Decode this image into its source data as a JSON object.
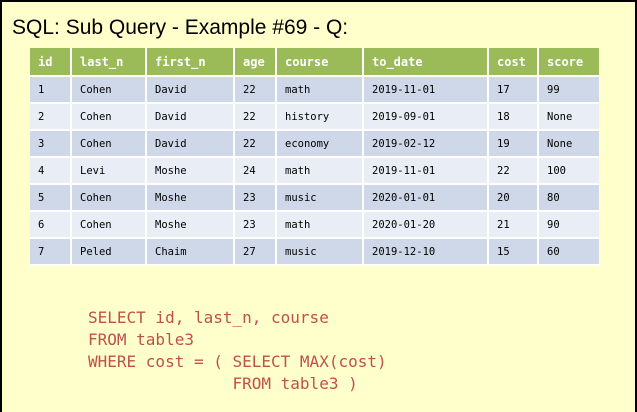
{
  "slide": {
    "title": "SQL: Sub Query - Example #69 - Q:"
  },
  "table": {
    "columns": [
      "id",
      "last_n",
      "first_n",
      "age",
      "course",
      "to_date",
      "cost",
      "score"
    ],
    "rows": [
      [
        "1",
        "Cohen",
        "David",
        "22",
        "math",
        "2019-11-01",
        "17",
        "99"
      ],
      [
        "2",
        "Cohen",
        "David",
        "22",
        "history",
        "2019-09-01",
        "18",
        "None"
      ],
      [
        "3",
        "Cohen",
        "David",
        "22",
        "economy",
        "2019-02-12",
        "19",
        "None"
      ],
      [
        "4",
        "Levi",
        "Moshe",
        "24",
        "math",
        "2019-11-01",
        "22",
        "100"
      ],
      [
        "5",
        "Cohen",
        "Moshe",
        "23",
        "music",
        "2020-01-01",
        "20",
        "80"
      ],
      [
        "6",
        "Cohen",
        "Moshe",
        "23",
        "math",
        "2020-01-20",
        "21",
        "90"
      ],
      [
        "7",
        "Peled",
        "Chaim",
        "27",
        "music",
        "2019-12-10",
        "15",
        "60"
      ]
    ],
    "colors": {
      "header_bg": "#9bbb59",
      "header_text": "#ffffff",
      "row_odd_bg": "#cfd8e8",
      "row_even_bg": "#e9edf5"
    }
  },
  "query": {
    "lines": [
      "SELECT id, last_n, course",
      "FROM table3",
      "WHERE cost = ( SELECT MAX(cost)",
      "               FROM table3 )"
    ],
    "color": "#c0504d"
  },
  "background_color": "#ffffcc"
}
